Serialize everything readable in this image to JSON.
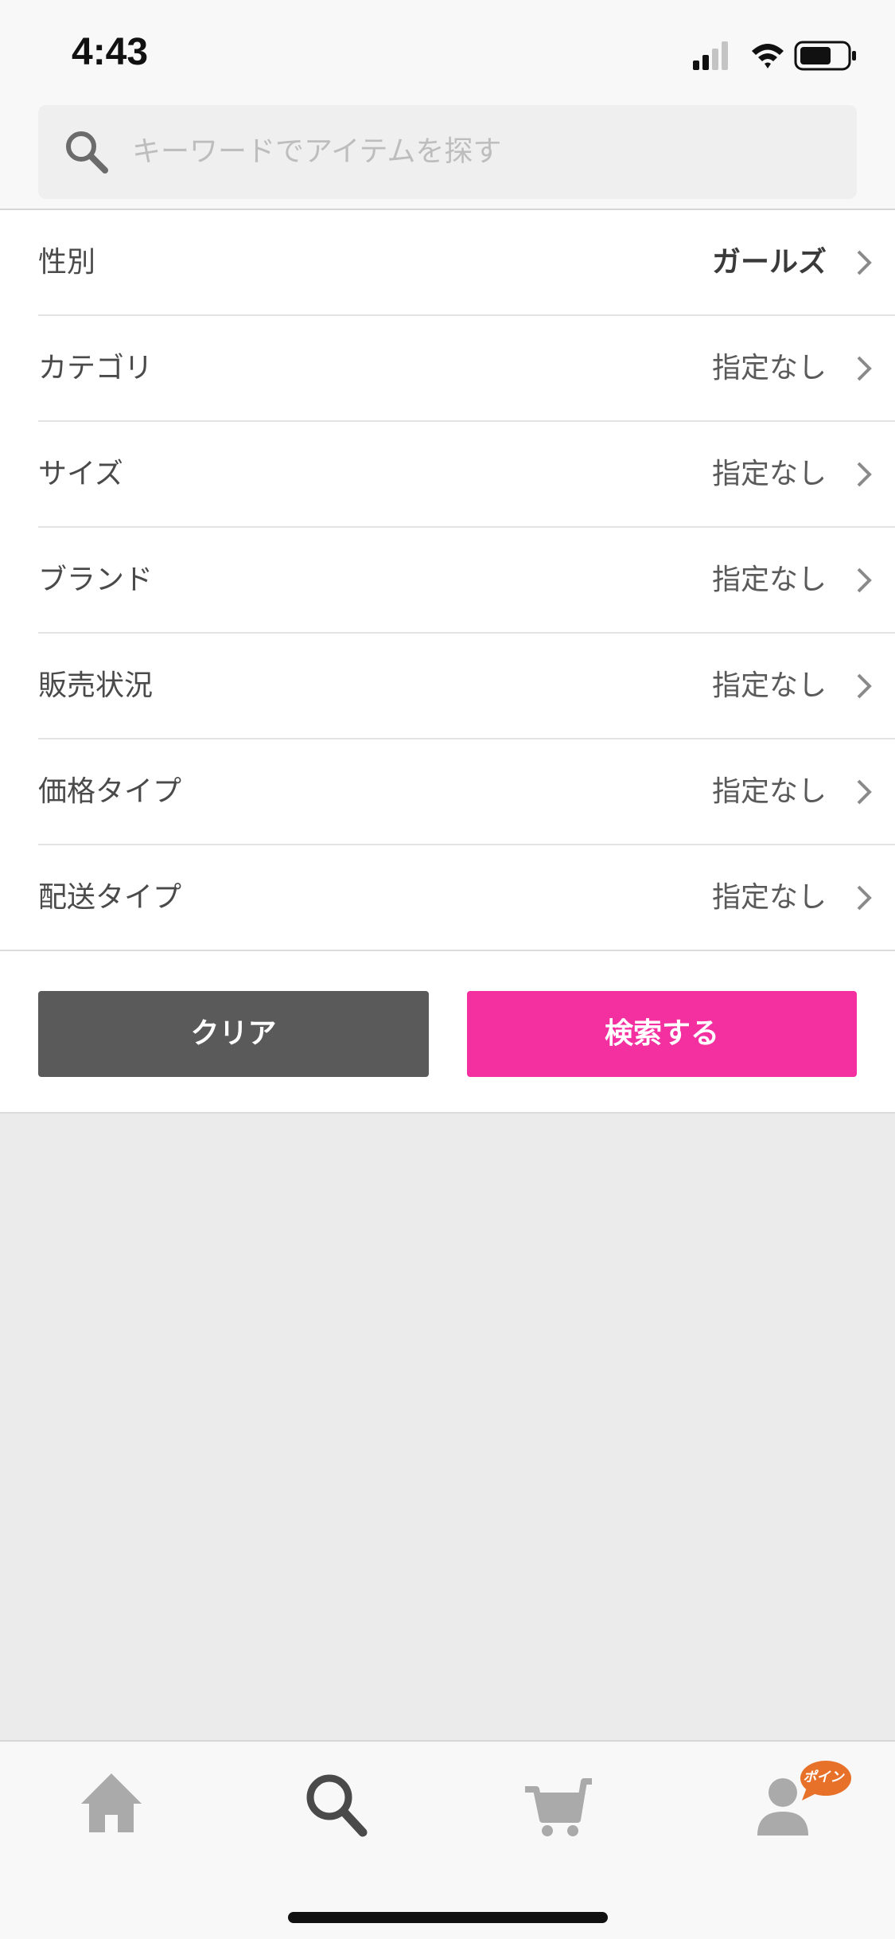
{
  "status_bar": {
    "time": "4:43"
  },
  "search": {
    "placeholder": "キーワードでアイテムを探す"
  },
  "filters": [
    {
      "label": "性別",
      "value": "ガールズ",
      "emphasized": true
    },
    {
      "label": "カテゴリ",
      "value": "指定なし",
      "emphasized": false
    },
    {
      "label": "サイズ",
      "value": "指定なし",
      "emphasized": false
    },
    {
      "label": "ブランド",
      "value": "指定なし",
      "emphasized": false
    },
    {
      "label": "販売状況",
      "value": "指定なし",
      "emphasized": false
    },
    {
      "label": "価格タイプ",
      "value": "指定なし",
      "emphasized": false
    },
    {
      "label": "配送タイプ",
      "value": "指定なし",
      "emphasized": false
    }
  ],
  "actions": {
    "clear_label": "クリア",
    "search_label": "検索する"
  },
  "tab_bar": {
    "tabs": [
      {
        "name": "home",
        "icon": "home-icon",
        "active": false
      },
      {
        "name": "search",
        "icon": "search-icon",
        "active": true
      },
      {
        "name": "cart",
        "icon": "cart-icon",
        "active": false
      },
      {
        "name": "account",
        "icon": "account-icon",
        "active": false
      }
    ],
    "points_badge": "ポイン"
  },
  "colors": {
    "accent": "#f42f9f",
    "clear_button": "#5a5a5a",
    "badge": "#e8712a",
    "inactive_icon": "#aaaaaa",
    "active_icon": "#4a4a4a"
  }
}
